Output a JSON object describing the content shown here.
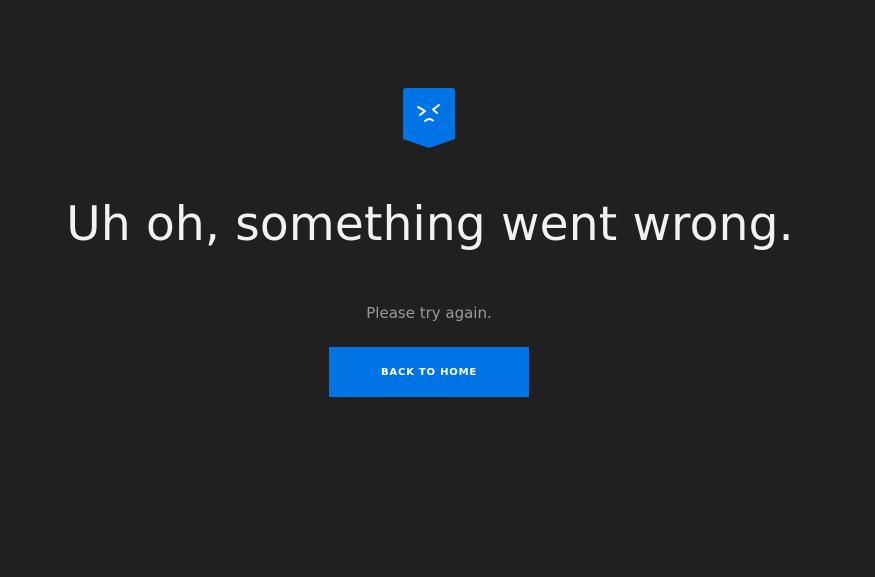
{
  "error_icon": {
    "name": "sad-face-badge-icon",
    "color": "#0074e4"
  },
  "headline": "Uh oh, something went wrong.",
  "subtext": "Please try again.",
  "home_button": {
    "label": "BACK TO HOME",
    "color": "#0074e4"
  },
  "background_color": "#202020"
}
